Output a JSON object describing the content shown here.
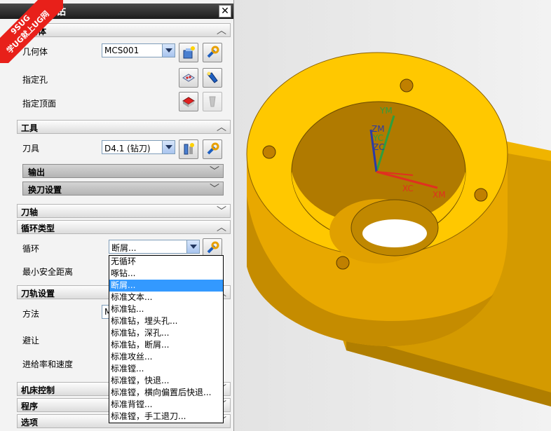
{
  "panel": {
    "title": "钻",
    "close_glyph": "✕",
    "badge": {
      "line1": "9SUG",
      "line2": "学UG就上UG网"
    },
    "sections": {
      "geometry": "几何体",
      "tool": "工具",
      "tool_axis": "刀轴",
      "cycle_type": "循环类型",
      "path_settings": "刀轨设置",
      "machine_control": "机床控制",
      "program": "程序",
      "options": "选项"
    },
    "geometry": {
      "geometry_label": "几何体",
      "geometry_value": "MCS001",
      "specify_holes": "指定孔",
      "specify_top": "指定顶面"
    },
    "tool": {
      "tool_label": "刀具",
      "tool_value": "D4.1 (钻刀)",
      "output": "输出",
      "tool_change": "换刀设置"
    },
    "cycle": {
      "cycle_label": "循环",
      "cycle_value": "断屑...",
      "min_clearance": "最小安全距离"
    },
    "path": {
      "method": "方法",
      "method_value": "M",
      "avoid": "避让",
      "feeds": "进给率和速度"
    },
    "cycle_options": [
      "无循环",
      "啄钻...",
      "断屑...",
      "标准文本...",
      "标准钻...",
      "标准钻，埋头孔...",
      "标准钻，深孔...",
      "标准钻，断屑...",
      "标准攻丝...",
      "标准镗...",
      "标准镗，快退...",
      "标准镗，横向偏置后快退...",
      "标准背镗...",
      "标准镗，手工退刀..."
    ],
    "cycle_selected_index": 2
  },
  "viewport": {
    "axes": {
      "ym": "YM",
      "zm": "ZM",
      "yc": "YC",
      "zc": "ZC",
      "xc": "XC",
      "xm": "XM"
    },
    "part_color": "#ffc800",
    "axis_colors": {
      "y": "#2e9e3e",
      "z": "#2a3aa8",
      "x": "#e03020"
    }
  }
}
